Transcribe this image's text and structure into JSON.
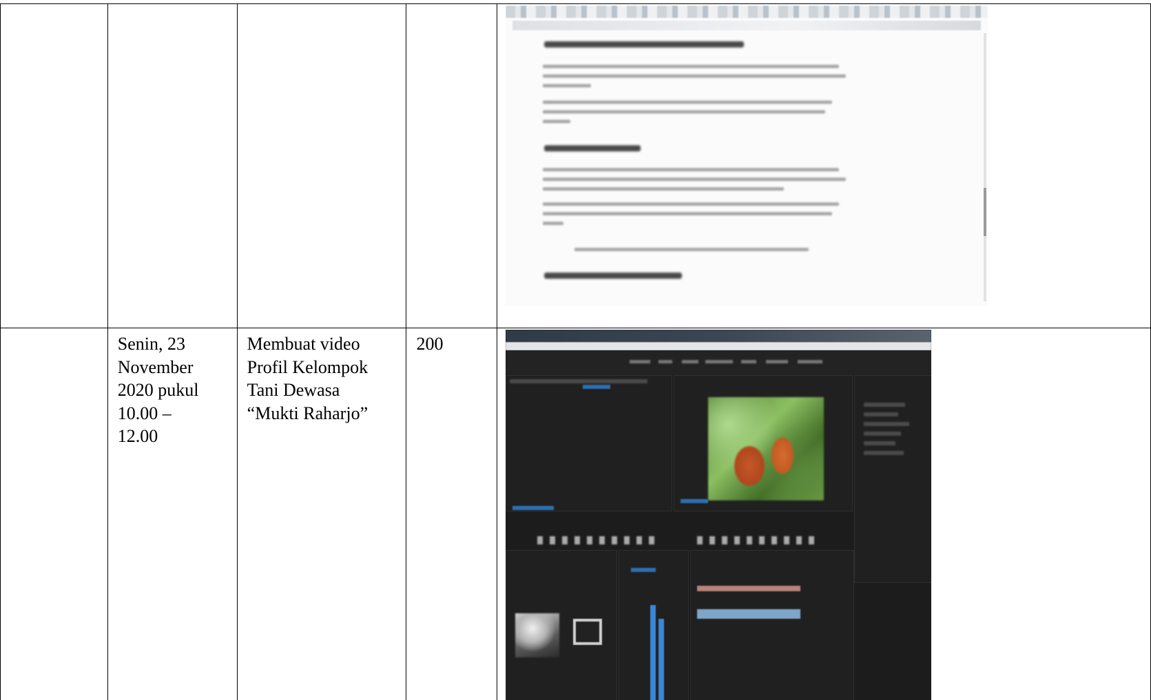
{
  "table": {
    "rows": [
      {
        "date_lines": [],
        "activity_lines": [],
        "duration": "",
        "evidence_icon": "browser-article-screenshot"
      },
      {
        "date_lines": [
          "Senin, 23",
          "November",
          "2020 pukul",
          "10.00 –",
          "12.00"
        ],
        "activity_lines": [
          "Membuat video",
          "Profil Kelompok",
          "Tani Dewasa",
          "“Mukti Raharjo”"
        ],
        "duration": "200",
        "evidence_icon": "video-editor-screenshot"
      }
    ]
  },
  "colors": {
    "border": "#000000",
    "editor_background": "#1c1c1c",
    "editor_accent": "#2d6fb1"
  }
}
